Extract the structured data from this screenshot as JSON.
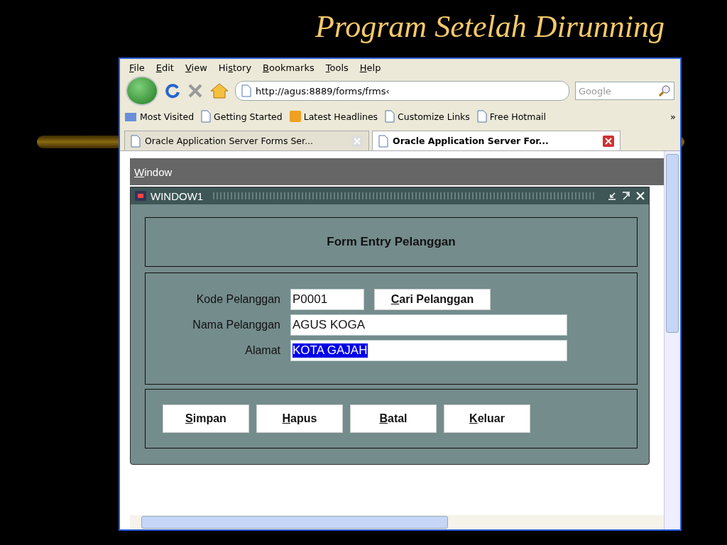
{
  "slide": {
    "title": "Program Setelah Dirunning"
  },
  "browser": {
    "menu": [
      {
        "key": "F",
        "rest": "ile"
      },
      {
        "key": "E",
        "rest": "dit"
      },
      {
        "key": "V",
        "rest": "iew"
      },
      {
        "pre": "Hi",
        "key": "s",
        "rest": "tory"
      },
      {
        "key": "B",
        "rest": "ookmarks"
      },
      {
        "key": "T",
        "rest": "ools"
      },
      {
        "key": "H",
        "rest": "elp"
      }
    ],
    "url": "http://agus:8889/forms/frms‹",
    "search_placeholder": "Google",
    "bookmarks": [
      {
        "kind": "folder",
        "label": "Most Visited"
      },
      {
        "kind": "page",
        "label": "Getting Started"
      },
      {
        "kind": "feed",
        "label": "Latest Headlines"
      },
      {
        "kind": "page",
        "label": "Customize Links"
      },
      {
        "kind": "page",
        "label": "Free Hotmail"
      }
    ],
    "bookmarks_more": "»",
    "tabs": [
      {
        "label": "Oracle Application Server Forms Ser...",
        "selected": false
      },
      {
        "label": "Oracle Application Server For...",
        "selected": true
      }
    ]
  },
  "forms": {
    "menu": [
      {
        "key": "W",
        "rest": "indow"
      }
    ],
    "window_title": "WINDOW1",
    "header": "Form Entry Pelanggan",
    "fields": [
      {
        "label": "Kode Pelanggan",
        "value": "P0001",
        "kind": "short",
        "selected": false
      },
      {
        "label": "Nama Pelanggan",
        "value": "AGUS KOGA",
        "kind": "long",
        "selected": false
      },
      {
        "label": "Alamat",
        "value": "KOTA GAJAH",
        "kind": "long",
        "selected": true
      }
    ],
    "lookup_button": {
      "key": "C",
      "rest": "ari Pelanggan"
    },
    "buttons": [
      {
        "key": "S",
        "rest": "impan"
      },
      {
        "key": "H",
        "rest": "apus"
      },
      {
        "key": "B",
        "rest": "atal"
      },
      {
        "key": "K",
        "rest": "eluar"
      }
    ]
  }
}
